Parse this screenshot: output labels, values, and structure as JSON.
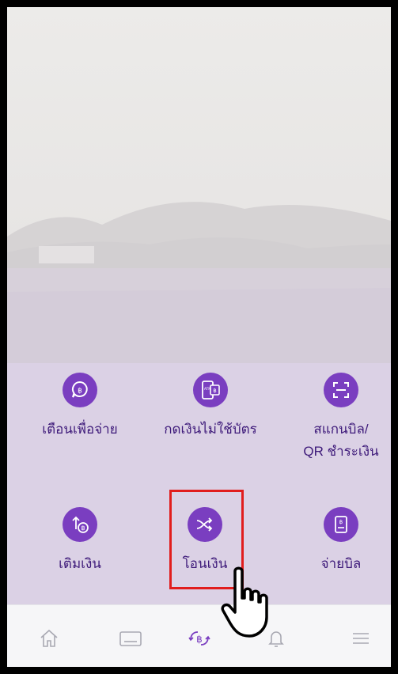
{
  "quick_actions": {
    "notify_to_pay": {
      "label": "เตือนเพื่อจ่าย",
      "icon": "chat-baht-icon"
    },
    "cardless_withdraw": {
      "label": "กดเงินไม่ใช้บัตร",
      "icon": "atm-phone-icon"
    },
    "scan_bill": {
      "label_line1": "สแกนบิล/",
      "label_line2": "QR ชำระเงิน",
      "icon": "scan-frame-icon"
    },
    "top_up": {
      "label": "เติมเงิน",
      "icon": "arrow-up-baht-icon"
    },
    "transfer": {
      "label": "โอนเงิน",
      "icon": "shuffle-arrows-icon"
    },
    "pay_bill": {
      "label": "จ่ายบิล",
      "icon": "bill-icon"
    }
  },
  "bottom_nav": {
    "items": [
      "home-icon",
      "card-icon",
      "transfer-baht-icon",
      "bell-icon",
      "menu-icon"
    ]
  },
  "annotation": {
    "highlighted_item": "transfer",
    "pointer": "hand-pointer-icon"
  },
  "colors": {
    "accent": "#7a3ec0",
    "label": "#3e1a7a",
    "highlight": "#e11d1d"
  }
}
